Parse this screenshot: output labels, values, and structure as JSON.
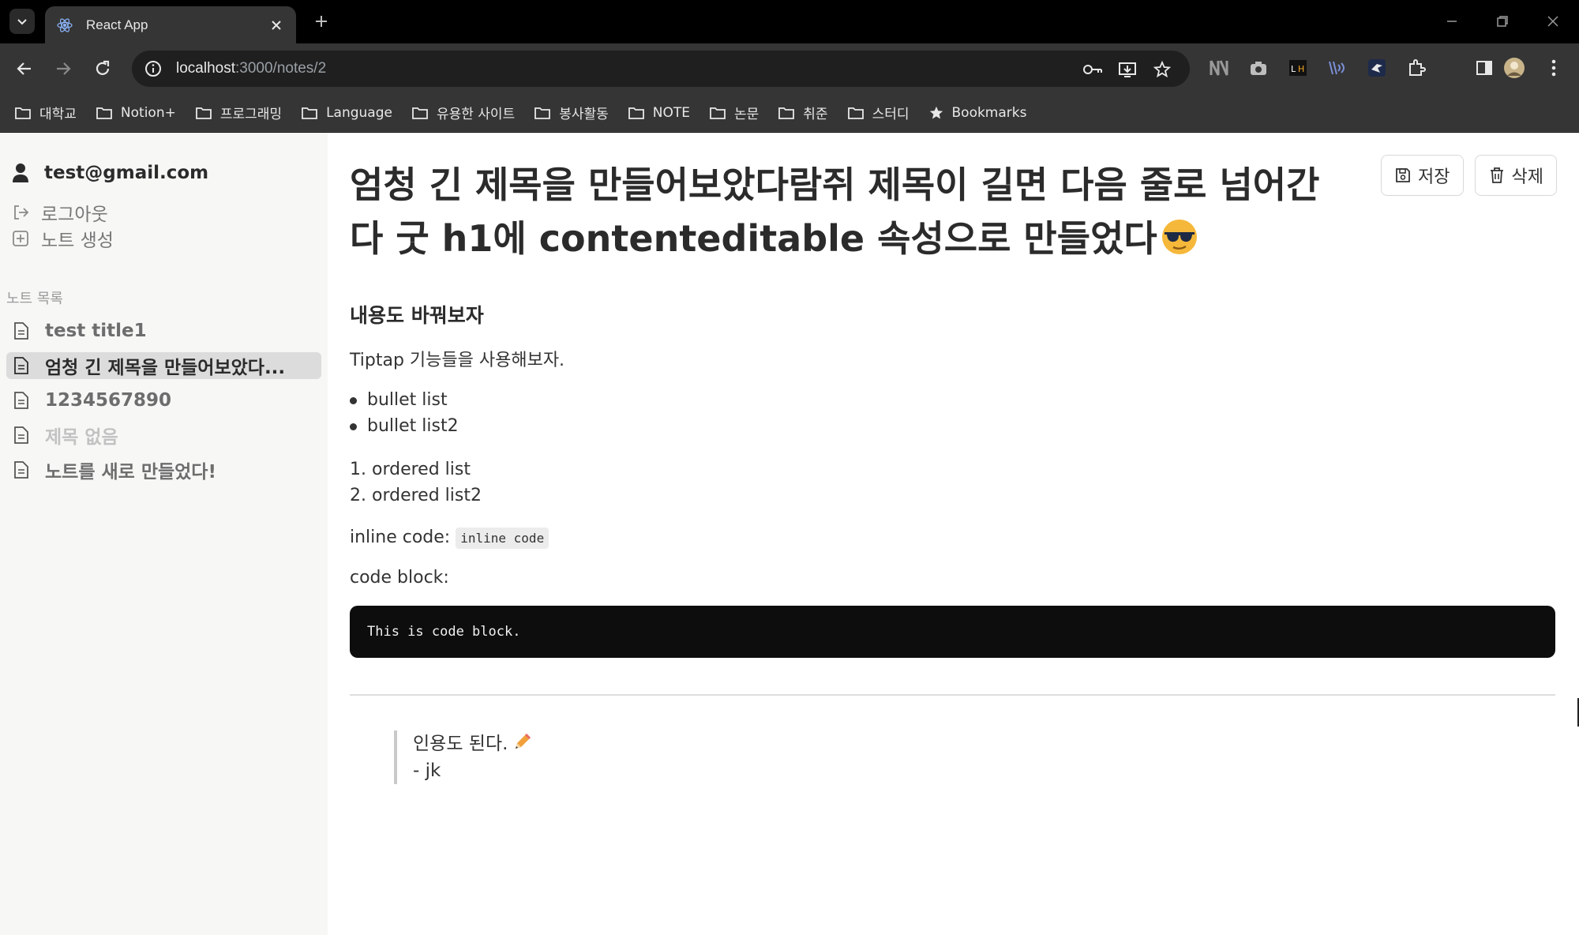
{
  "browser": {
    "tab_title": "React App",
    "url_host": "localhost",
    "url_path": ":3000/notes/2",
    "bookmarks": [
      "대학교",
      "Notion+",
      "프로그래밍",
      "Language",
      "유용한 사이트",
      "봉사활동",
      "NOTE",
      "논문",
      "취준",
      "스터디",
      "Bookmarks"
    ]
  },
  "sidebar": {
    "email": "test@gmail.com",
    "logout_label": "로그아웃",
    "create_label": "노트 생성",
    "section_label": "노트 목록",
    "notes": [
      {
        "label": "test title1",
        "active": false
      },
      {
        "label": "엄청 긴 제목을 만들어보았다...",
        "active": true
      },
      {
        "label": "1234567890",
        "active": false
      },
      {
        "label": "제목 없음",
        "active": false
      },
      {
        "label": "노트를 새로 만들었다!",
        "active": false
      }
    ]
  },
  "actions": {
    "save_label": "저장",
    "delete_label": "삭제"
  },
  "note": {
    "title": "엄청 긴 제목을 만들어보았다람쥐 제목이 길면 다음 줄로 넘어간다 굿 h1에 contenteditable 속성으로 만들었다",
    "heading": "내용도 바꿔보자",
    "intro": "Tiptap 기능들을 사용해보자.",
    "bullets": [
      "bullet list",
      "bullet list2"
    ],
    "ordered": [
      "1. ordered list",
      "2. ordered list2"
    ],
    "inline_code_label": "inline code:",
    "inline_code": "inline code",
    "code_block_label": "code block:",
    "code_block": "This is code block.",
    "quote_line1": "인용도 된다.",
    "quote_line2": "- jk"
  },
  "colors": {
    "sidebar_bg": "#f7f7f5",
    "active_item_bg": "#dcdcdc",
    "code_block_bg": "#0d0d0d"
  }
}
